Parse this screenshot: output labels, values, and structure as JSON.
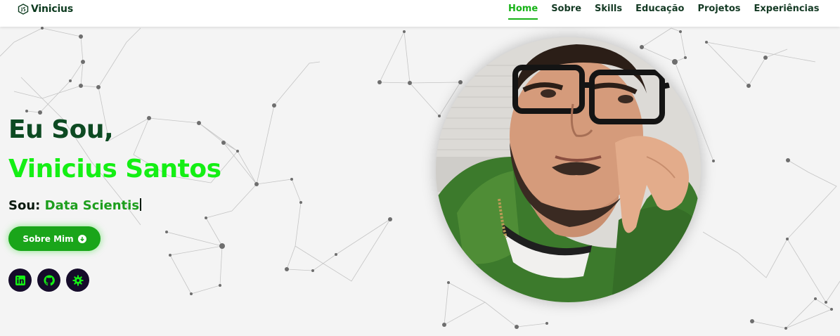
{
  "brand": {
    "name": "Vinicius",
    "logo_icon": "js-hexagon-icon"
  },
  "nav": {
    "items": [
      {
        "label": "Home",
        "active": true
      },
      {
        "label": "Sobre",
        "active": false
      },
      {
        "label": "Skills",
        "active": false
      },
      {
        "label": "Educação",
        "active": false
      },
      {
        "label": "Projetos",
        "active": false
      },
      {
        "label": "Experiências",
        "active": false
      }
    ]
  },
  "hero": {
    "greeting": "Eu Sou,",
    "name": "Vinicius Santos",
    "role_label": "Sou:",
    "role_value": "Data Scientis",
    "about_button": "Sobre Mim",
    "about_icon": "arrow-down-circle-icon"
  },
  "socials": [
    {
      "icon": "linkedin-icon"
    },
    {
      "icon": "github-icon"
    },
    {
      "icon": "kaggle-gear-icon"
    }
  ],
  "colors": {
    "accent": "#17b317",
    "name_green": "#14ef14",
    "dark_green": "#0d4a22",
    "social_bg": "#150b2a",
    "button_green": "#1aa51a"
  }
}
